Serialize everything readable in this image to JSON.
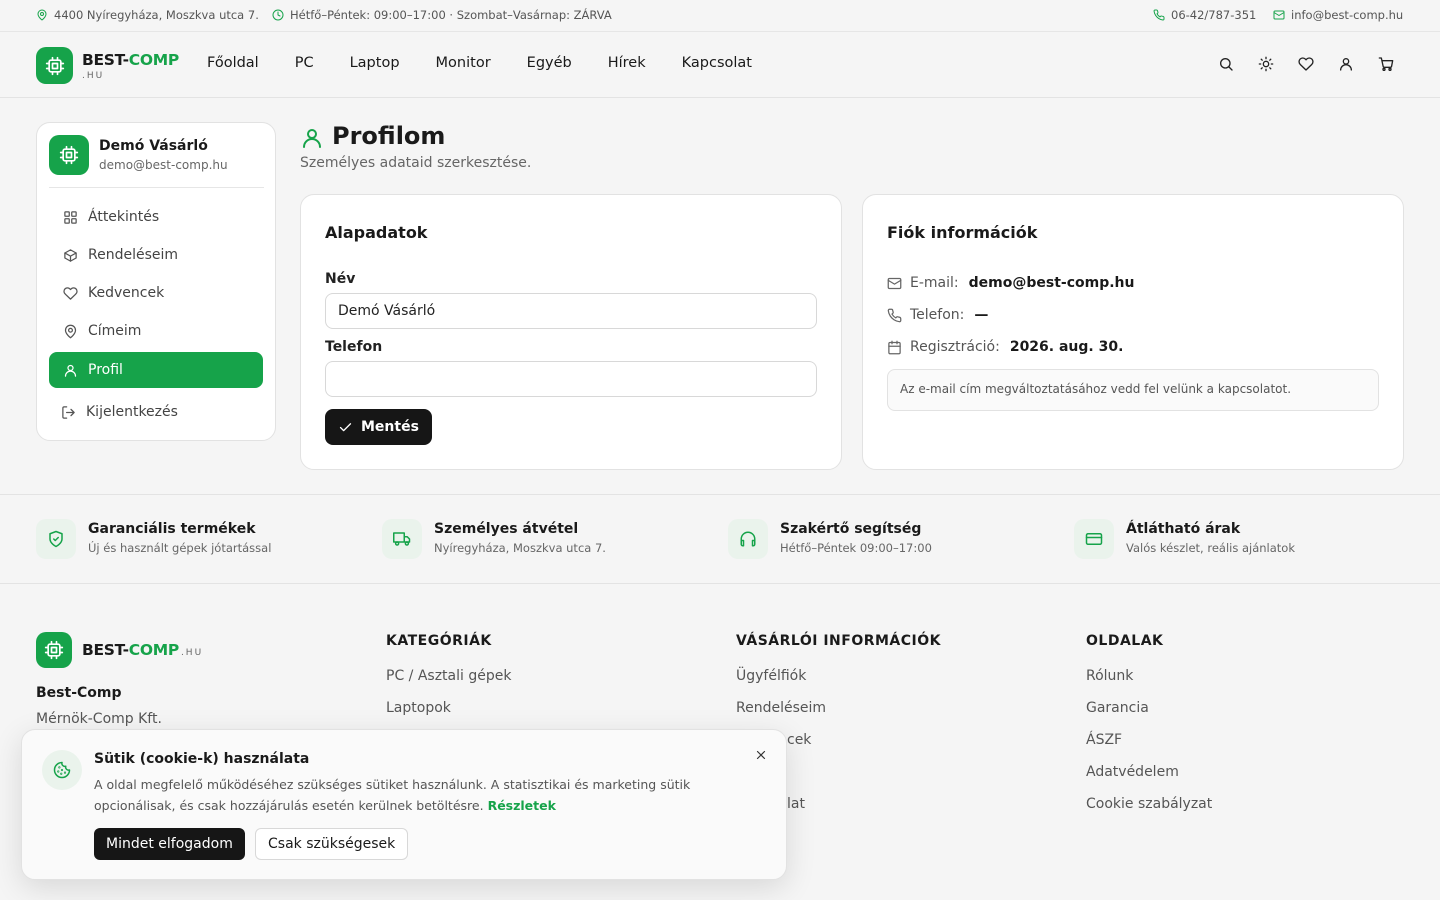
{
  "topbar": {
    "address": "4400 Nyíregyháza, Moszkva utca 7.",
    "hours": "Hétfő–Péntek: 09:00–17:00 · Szombat–Vasárnap: ZÁRVA",
    "phone": "06-42/787-351",
    "email": "info@best-comp.hu"
  },
  "brand": {
    "prefix": "BEST-",
    "name": "COMP",
    "tld": ".HU"
  },
  "nav": [
    "Főoldal",
    "PC",
    "Laptop",
    "Monitor",
    "Egyéb",
    "Hírek",
    "Kapcsolat"
  ],
  "header_icons": [
    "search-icon",
    "theme-toggle-icon",
    "heart-icon",
    "user-icon",
    "cart-icon"
  ],
  "sidebar": {
    "name": "Demó Vásárló",
    "email": "demo@best-comp.hu",
    "items": [
      {
        "label": "Áttekintés",
        "icon": "grid-icon"
      },
      {
        "label": "Rendeléseim",
        "icon": "package-icon"
      },
      {
        "label": "Kedvencek",
        "icon": "heart-icon"
      },
      {
        "label": "Címeim",
        "icon": "map-pin-icon"
      },
      {
        "label": "Profil",
        "icon": "user-icon",
        "active": true
      },
      {
        "label": "Kijelentkezés",
        "icon": "logout-icon"
      }
    ]
  },
  "page": {
    "title": "Profilom",
    "subtitle": "Személyes adataid szerkesztése."
  },
  "basic": {
    "title": "Alapadatok",
    "name_label": "Név",
    "name_value": "Demó Vásárló",
    "phone_label": "Telefon",
    "phone_value": "",
    "save": "Mentés"
  },
  "account": {
    "title": "Fiók információk",
    "email_label": "E-mail:",
    "email_value": "demo@best-comp.hu",
    "phone_label": "Telefon:",
    "phone_value": "—",
    "reg_label": "Regisztráció:",
    "reg_value": "2026. aug. 30.",
    "notice": "Az e-mail cím megváltoztatásához vedd fel velünk a kapcsolatot."
  },
  "features": [
    {
      "title": "Garanciális termékek",
      "sub": "Új és használt gépek jótartással"
    },
    {
      "title": "Személyes átvétel",
      "sub": "Nyíregyháza, Moszkva utca 7."
    },
    {
      "title": "Szakértő segítség",
      "sub": "Hétfő–Péntek 09:00–17:00"
    },
    {
      "title": "Átlátható árak",
      "sub": "Valós készlet, reális ajánlatok"
    }
  ],
  "footer": {
    "company": "Best-Comp",
    "company_sub": "Mérnök-Comp Kft.",
    "categories_title": "KATEGÓRIÁK",
    "categories": [
      "PC / Asztali gépek",
      "Laptopok"
    ],
    "customer_title": "VÁSÁRLÓI INFORMÁCIÓK",
    "customer": [
      "Ügyfélfiók",
      "Rendeléseim",
      "cek",
      "",
      "lat"
    ],
    "pages_title": "OLDALAK",
    "pages": [
      "Rólunk",
      "Garancia",
      "ÁSZF",
      "Adatvédelem",
      "Cookie szabályzat"
    ]
  },
  "cookie": {
    "title": "Sütik (cookie-k) használata",
    "text": "A oldal megfelelő működéséhez szükséges sütiket használunk. A statisztikai és marketing sütik opcionálisak, és csak hozzájárulás esetén kerülnek betöltésre.",
    "link": "Részletek",
    "accept": "Mindet elfogadom",
    "necessary": "Csak szükségesek"
  },
  "colors": {
    "accent": "#16a34a",
    "dark_button": "#161616",
    "background": "#f5f5f5"
  }
}
